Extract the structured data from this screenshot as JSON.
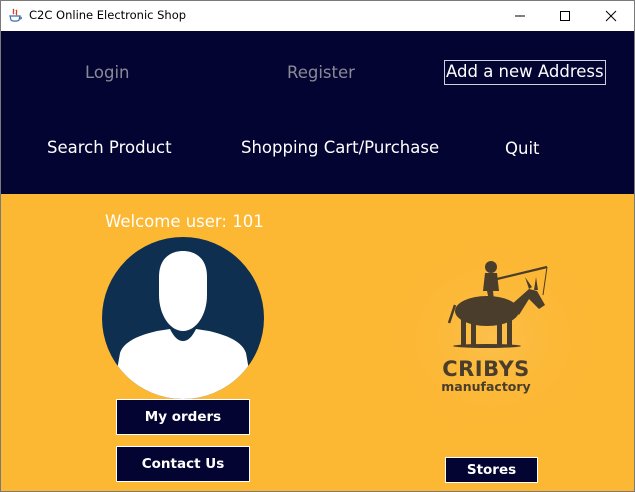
{
  "window": {
    "title": "C2C Online Electronic Shop",
    "controls": {
      "minimize_icon": "minimize-icon",
      "maximize_icon": "maximize-icon",
      "close_icon": "close-icon"
    }
  },
  "nav": {
    "login": "Login",
    "register": "Register",
    "add_address": "Add a new Address",
    "search_product": "Search Product",
    "shopping_cart": "Shopping Cart/Purchase",
    "quit": "Quit"
  },
  "main": {
    "welcome": "Welcome user: 101",
    "avatar_icon": "user-avatar-icon",
    "my_orders": "My orders",
    "contact_us": "Contact Us",
    "stores": "Stores",
    "logo": {
      "name": "CRIBYS",
      "subtitle": "manufactory"
    }
  },
  "colors": {
    "nav_background": "#040433",
    "content_background": "#fcb733",
    "button_background": "#040433",
    "avatar_circle": "#0e2f4f",
    "logo_brown": "#4a3d2b",
    "disabled_text": "#8a8a96"
  }
}
